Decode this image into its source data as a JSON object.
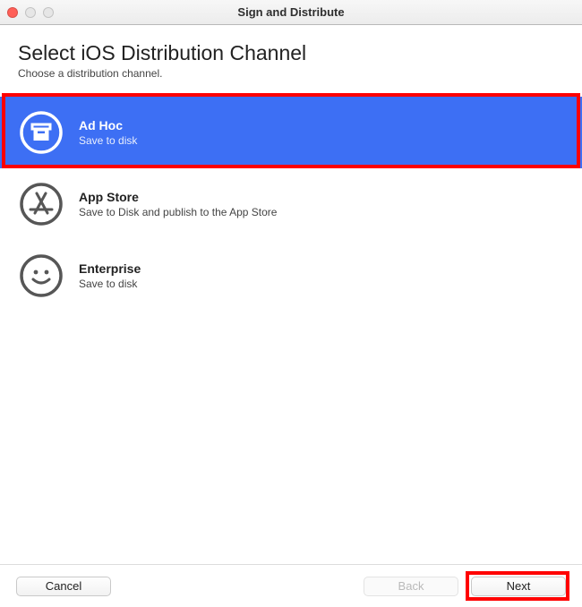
{
  "window": {
    "title": "Sign and Distribute"
  },
  "header": {
    "heading": "Select iOS Distribution Channel",
    "subheading": "Choose a distribution channel."
  },
  "options": [
    {
      "title": "Ad Hoc",
      "desc": "Save to disk",
      "selected": true,
      "icon": "archive-box-icon"
    },
    {
      "title": "App Store",
      "desc": "Save to Disk and publish to the App Store",
      "selected": false,
      "icon": "app-store-icon"
    },
    {
      "title": "Enterprise",
      "desc": "Save to disk",
      "selected": false,
      "icon": "smiley-icon"
    }
  ],
  "footer": {
    "cancel": "Cancel",
    "back": "Back",
    "next": "Next",
    "back_enabled": false
  },
  "colors": {
    "selection": "#3d6ff4",
    "highlight": "#ff0000"
  }
}
